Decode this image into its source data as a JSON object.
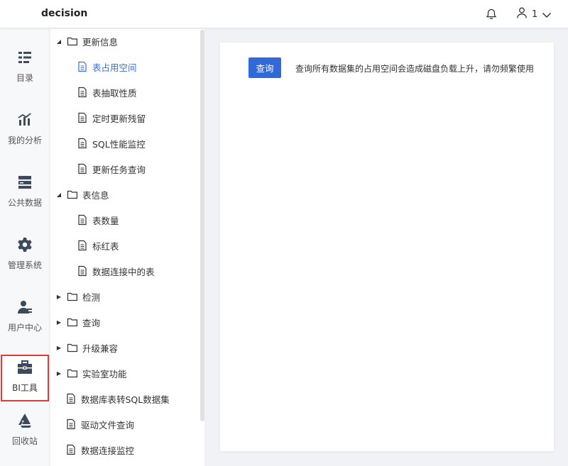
{
  "header": {
    "title": "decision",
    "user_name": "1"
  },
  "leftnav": {
    "items": [
      {
        "label": "目录",
        "icon": "catalog-icon"
      },
      {
        "label": "我的分析",
        "icon": "analysis-icon"
      },
      {
        "label": "公共数据",
        "icon": "public-data-icon"
      },
      {
        "label": "管理系统",
        "icon": "gear-icon"
      },
      {
        "label": "用户中心",
        "icon": "user-center-icon"
      },
      {
        "label": "BI工具",
        "icon": "toolbox-icon",
        "active": true
      },
      {
        "label": "回收站",
        "icon": "recycle-icon"
      }
    ]
  },
  "tree": {
    "nodes": [
      {
        "label": "更新信息",
        "type": "folder",
        "expanded": true
      },
      {
        "label": "表占用空间",
        "type": "file",
        "selected": true
      },
      {
        "label": "表抽取性质",
        "type": "file"
      },
      {
        "label": "定时更新残留",
        "type": "file"
      },
      {
        "label": "SQL性能监控",
        "type": "file"
      },
      {
        "label": "更新任务查询",
        "type": "file"
      },
      {
        "label": "表信息",
        "type": "folder",
        "expanded": true
      },
      {
        "label": "表数量",
        "type": "file"
      },
      {
        "label": "标红表",
        "type": "file"
      },
      {
        "label": "数据连接中的表",
        "type": "file"
      },
      {
        "label": "检测",
        "type": "folder",
        "expanded": false
      },
      {
        "label": "查询",
        "type": "folder",
        "expanded": false
      },
      {
        "label": "升级兼容",
        "type": "folder",
        "expanded": false
      },
      {
        "label": "实验室功能",
        "type": "folder",
        "expanded": false
      },
      {
        "label": "数据库表转SQL数据集",
        "type": "file"
      },
      {
        "label": "驱动文件查询",
        "type": "file"
      },
      {
        "label": "数据连接监控",
        "type": "file"
      }
    ]
  },
  "main": {
    "query_button": "查询",
    "hint": "查询所有数据集的占用空间会造成磁盘负载上升，请勿频繁使用"
  },
  "colors": {
    "accent": "#3169d8",
    "active_border": "#e53935",
    "nav_icon": "#3d4a5c"
  }
}
